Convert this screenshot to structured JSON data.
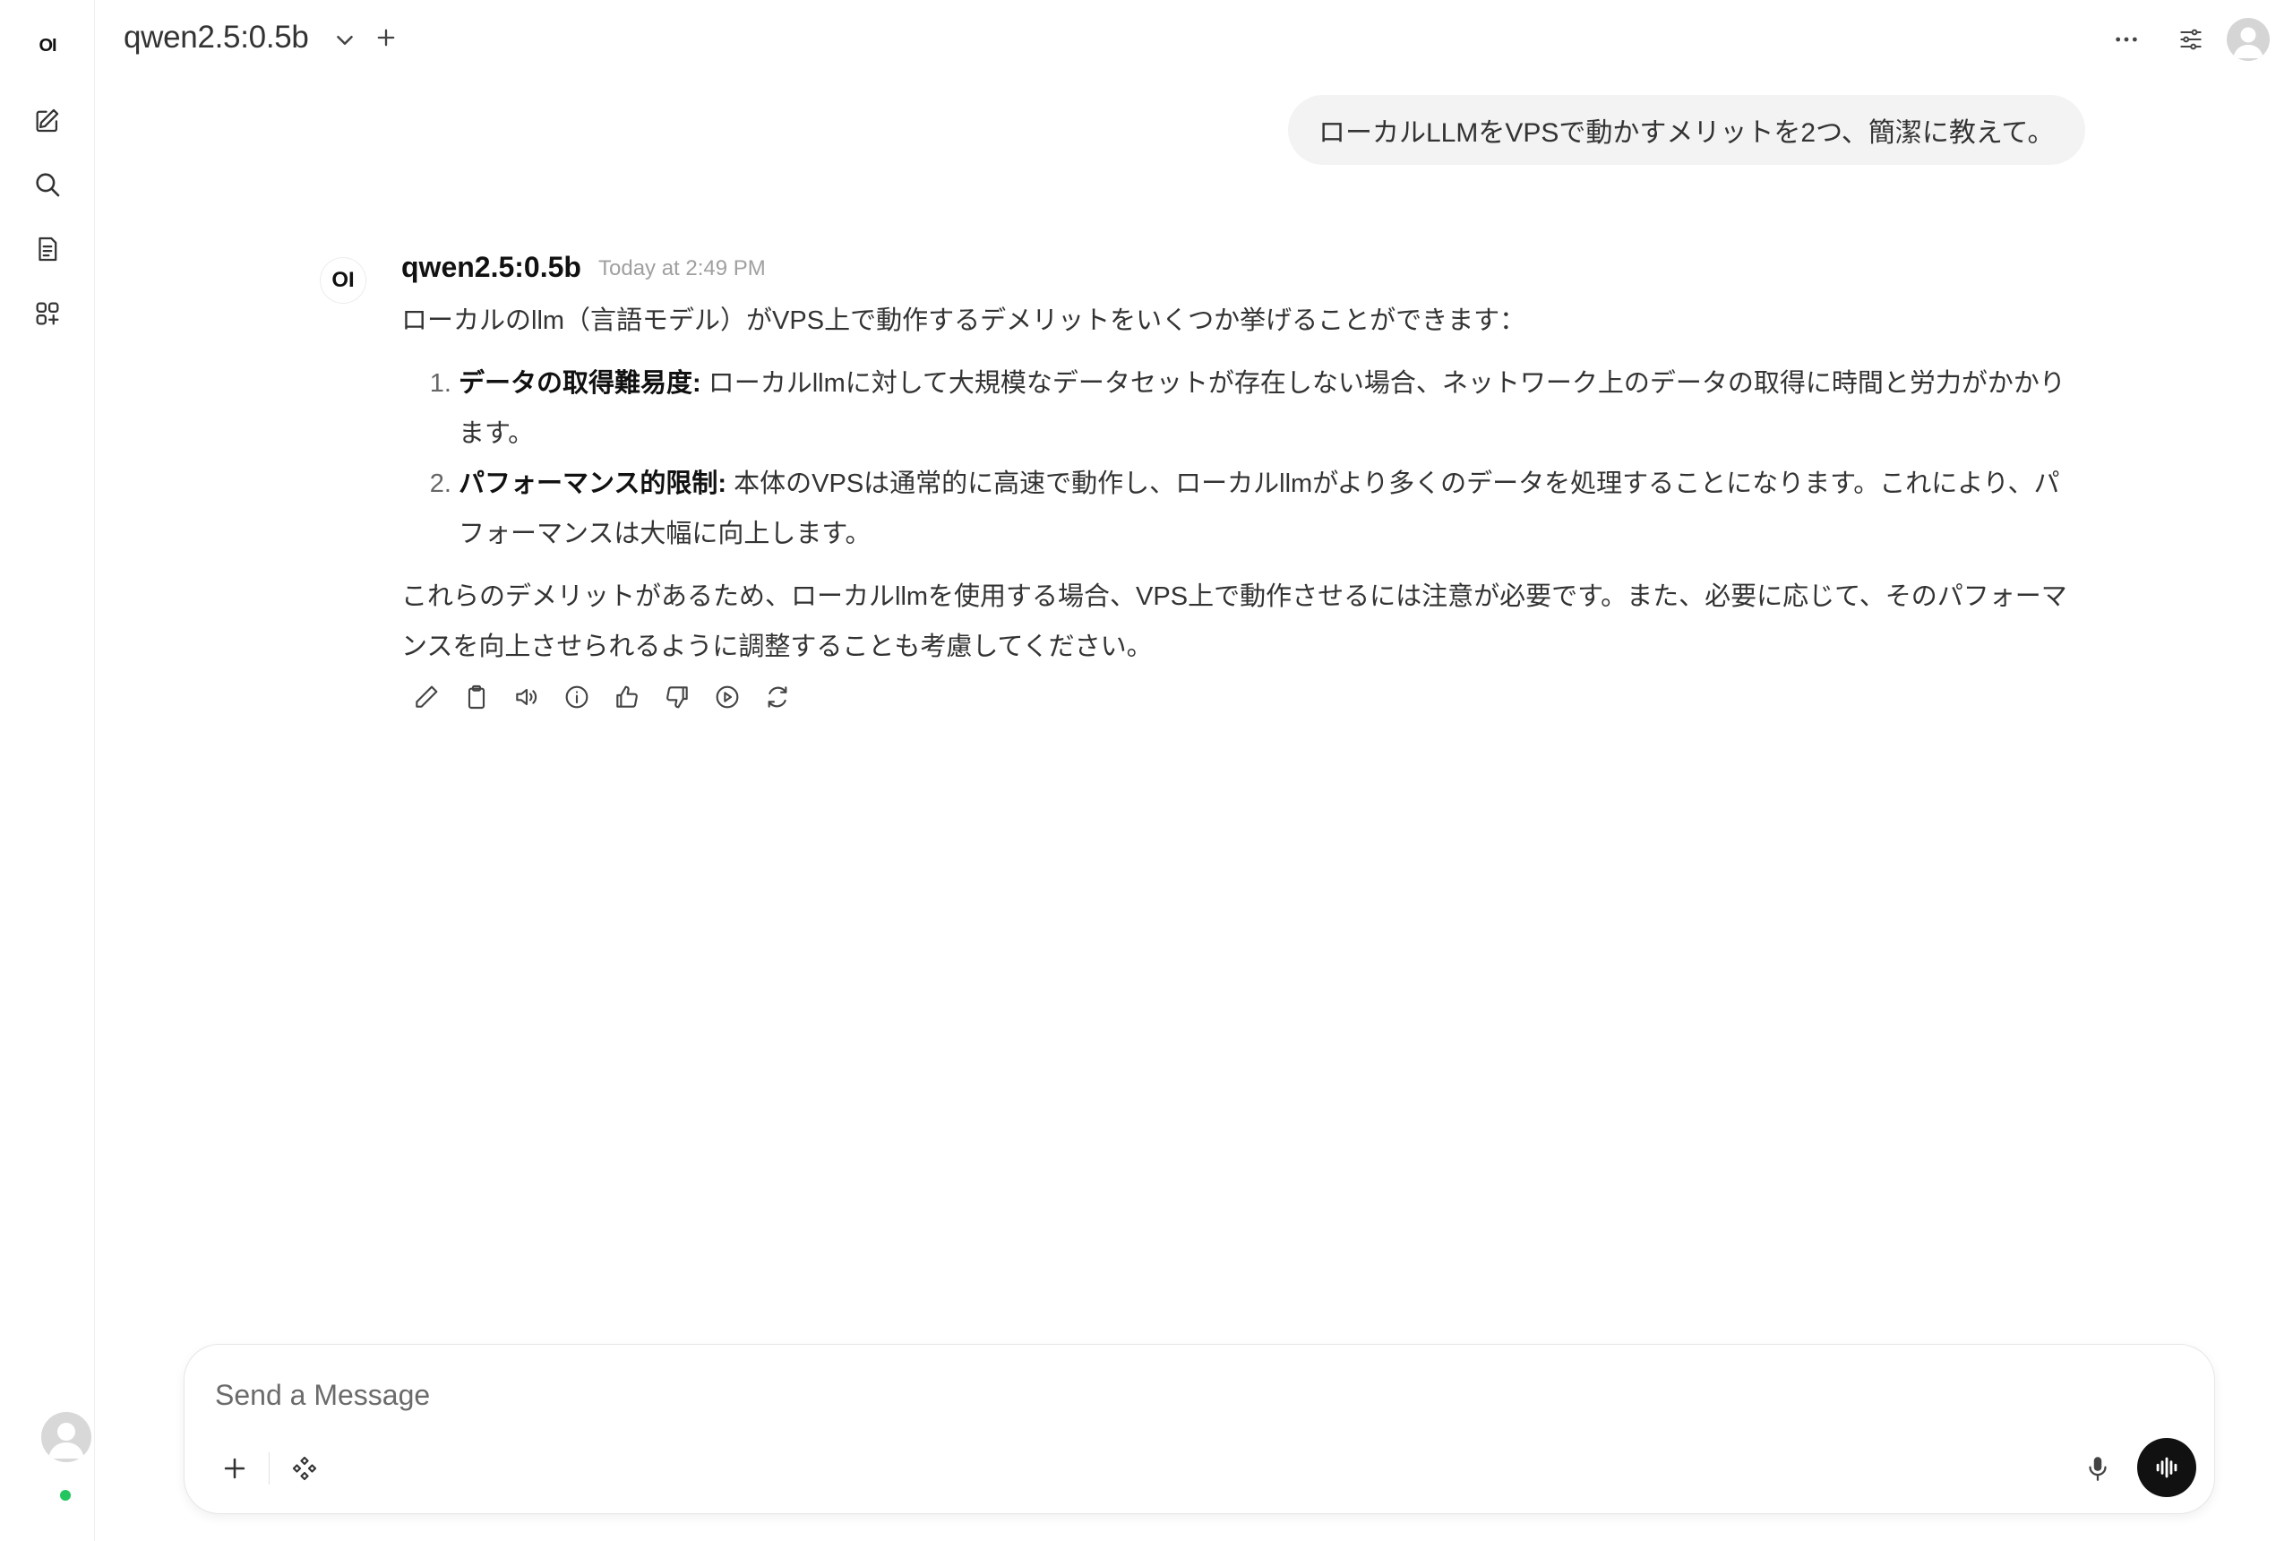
{
  "app": {
    "logo_text": "OI"
  },
  "header": {
    "model_name": "qwen2.5:0.5b"
  },
  "sidebar": {
    "items": [
      {
        "name": "new-chat",
        "icon": "pencil-square-icon"
      },
      {
        "name": "search",
        "icon": "search-icon"
      },
      {
        "name": "notes",
        "icon": "document-icon"
      },
      {
        "name": "workspace",
        "icon": "apps-plus-icon"
      }
    ]
  },
  "chat": {
    "user_message": "ローカルLLMをVPSで動かすメリットを2つ、簡潔に教えて。",
    "assistant": {
      "avatar_text": "OI",
      "name": "qwen2.5:0.5b",
      "timestamp": "Today at 2:49 PM",
      "intro": "ローカルのllm（言語モデル）がVPS上で動作するデメリットをいくつか挙げることができます：",
      "items": [
        {
          "title": "データの取得難易度:",
          "text": " ローカルllmに対して大規模なデータセットが存在しない場合、ネットワーク上のデータの取得に時間と労力がかかります。"
        },
        {
          "title": "パフォーマンス的限制:",
          "text": " 本体のVPSは通常的に高速で動作し、ローカルllmがより多くのデータを処理することになります。これにより、パフォーマンスは大幅に向上します。"
        }
      ],
      "conclusion": "これらのデメリットがあるため、ローカルllmを使用する場合、VPS上で動作させるには注意が必要です。また、必要に応じて、そのパフォーマンスを向上させられるように調整することも考慮してください。"
    }
  },
  "composer": {
    "placeholder": "Send a Message",
    "value": ""
  },
  "colors": {
    "online": "#22c55e",
    "voice_button": "#111111",
    "bubble": "#f3f3f3"
  }
}
